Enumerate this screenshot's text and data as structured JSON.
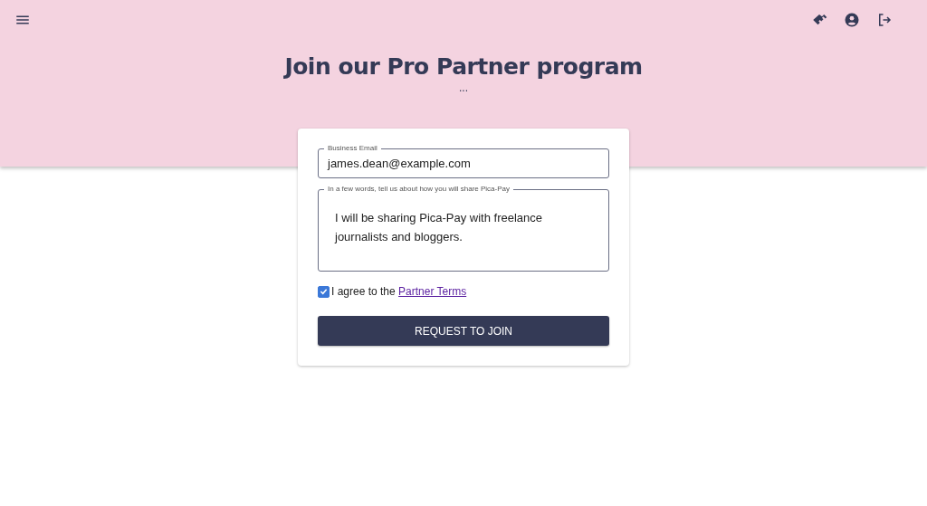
{
  "header": {
    "title": "Join our Pro Partner program",
    "subtitle": "..."
  },
  "form": {
    "email": {
      "label": "Business Email",
      "value": "james.dean@example.com"
    },
    "share": {
      "label": "In a few words, tell us about how you will share Pica-Pay",
      "value": "I will be sharing Pica-Pay with freelance journalists and bloggers."
    },
    "agree": {
      "checked": true,
      "text": "I agree to the ",
      "link": "Partner Terms"
    },
    "submit": "REQUEST TO JOIN"
  }
}
